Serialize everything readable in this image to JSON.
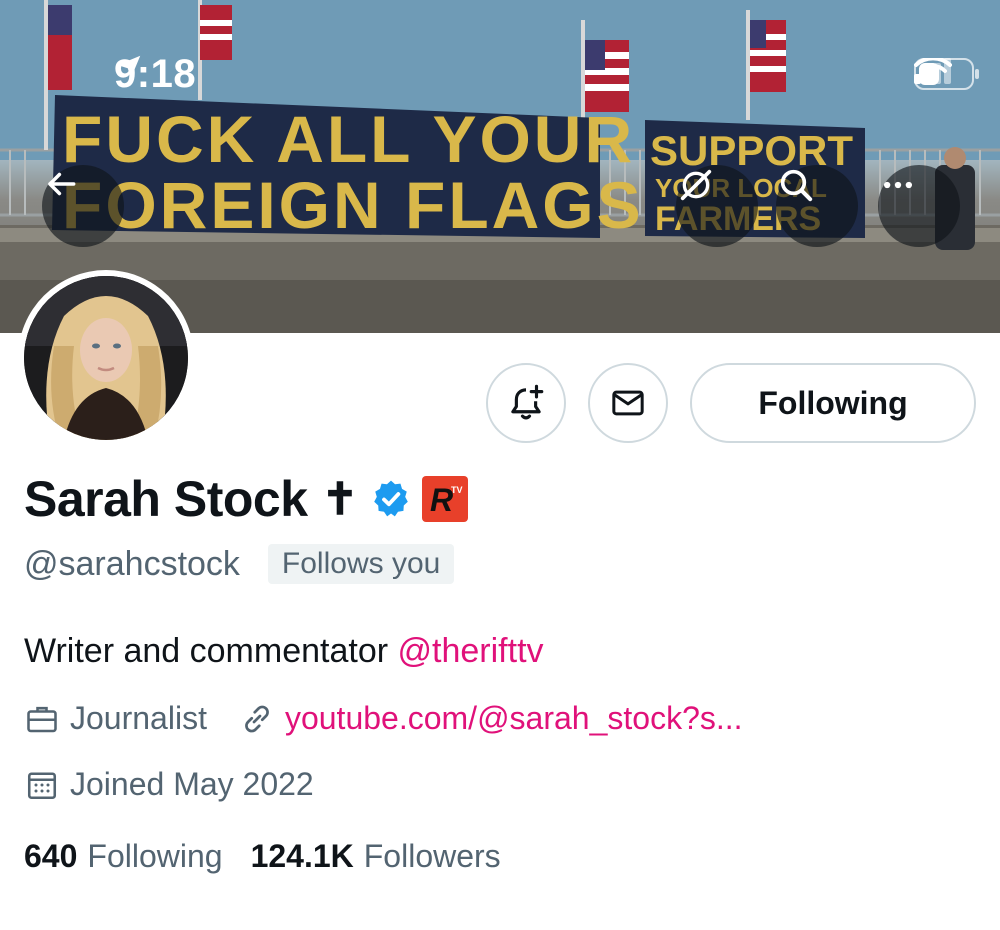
{
  "status_bar": {
    "time": "9:18",
    "icons": [
      "location-arrow-icon",
      "cellular-signal-icon",
      "wifi-icon",
      "battery-icon"
    ]
  },
  "banner": {
    "banner_text_left_line1": "FUCK ALL YOUR",
    "banner_text_left_line2": "FOREIGN FLAGS",
    "banner_text_right_line1": "SUPPORT",
    "banner_text_right_line2": "YOUR LOCAL",
    "banner_text_right_line3": "FARMERS"
  },
  "nav_buttons": [
    "back-arrow-icon",
    "grok-icon",
    "search-icon",
    "more-icon"
  ],
  "actions": {
    "notify_icon": "bell-plus-icon",
    "message_icon": "envelope-icon",
    "follow_label": "Following"
  },
  "profile": {
    "name": "Sarah Stock",
    "name_symbol": "✝",
    "affiliate_label": "R",
    "handle": "@sarahcstock",
    "follows_you": "Follows you",
    "bio_text": "Writer and commentator ",
    "bio_mention": "@therifttv",
    "profession": "Journalist",
    "website": "youtube.com/@sarah_stock?s...",
    "joined": "Joined May 2022"
  },
  "stats": {
    "following_count": "640",
    "following_label": "Following",
    "followers_count": "124.1K",
    "followers_label": "Followers"
  },
  "colors": {
    "accent_link": "#e0117a",
    "verified_blue": "#1d9bf0",
    "secondary_text": "#536471",
    "affiliate_red": "#e8402a"
  }
}
